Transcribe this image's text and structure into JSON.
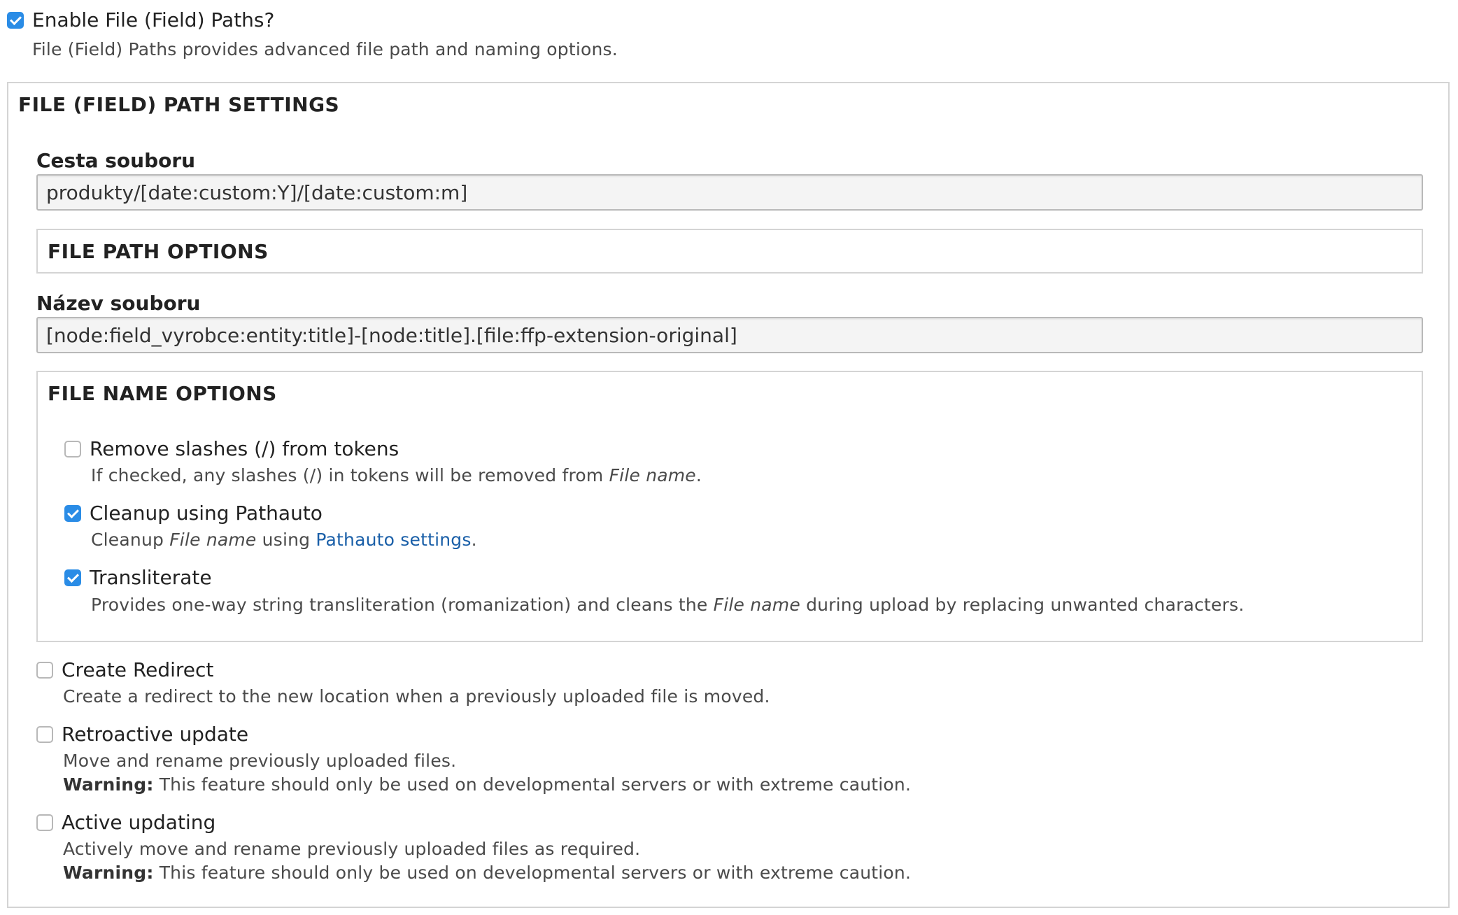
{
  "enable": {
    "label": "Enable File (Field) Paths?",
    "checked": true,
    "description": "File (Field) Paths provides advanced file path and naming options."
  },
  "settings": {
    "legend": "FILE (FIELD) PATH SETTINGS",
    "file_path": {
      "label": "Cesta souboru",
      "value": "produkty/[date:custom:Y]/[date:custom:m]"
    },
    "file_path_options": {
      "legend": "FILE PATH OPTIONS"
    },
    "file_name": {
      "label": "Název souboru",
      "value": "[node:field_vyrobce:entity:title]-[node:title].[file:ffp-extension-original]"
    },
    "file_name_options": {
      "legend": "FILE NAME OPTIONS",
      "remove_slashes": {
        "label": "Remove slashes (/) from tokens",
        "checked": false,
        "desc_before": "If checked, any slashes (/) in tokens will be removed from ",
        "desc_em": "File name",
        "desc_after": "."
      },
      "pathauto": {
        "label": "Cleanup using Pathauto",
        "checked": true,
        "desc_before": "Cleanup ",
        "desc_em": "File name",
        "desc_mid": " using ",
        "desc_link": "Pathauto settings",
        "desc_after": "."
      },
      "transliterate": {
        "label": "Transliterate",
        "checked": true,
        "desc_before": "Provides one-way string transliteration (romanization) and cleans the ",
        "desc_em": "File name",
        "desc_after": " during upload by replacing unwanted characters."
      }
    },
    "create_redirect": {
      "label": "Create Redirect",
      "checked": false,
      "description": "Create a redirect to the new location when a previously uploaded file is moved."
    },
    "retroactive_update": {
      "label": "Retroactive update",
      "checked": false,
      "description": "Move and rename previously uploaded files.",
      "warning_label": "Warning:",
      "warning_text": " This feature should only be used on developmental servers or with extreme caution."
    },
    "active_updating": {
      "label": "Active updating",
      "checked": false,
      "description": "Actively move and rename previously uploaded files as required.",
      "warning_label": "Warning:",
      "warning_text": " This feature should only be used on developmental servers or with extreme caution."
    }
  },
  "colors": {
    "checkbox_checked": "#2a8ce6",
    "link": "#1a5fa8",
    "border": "#d4d4d4"
  }
}
